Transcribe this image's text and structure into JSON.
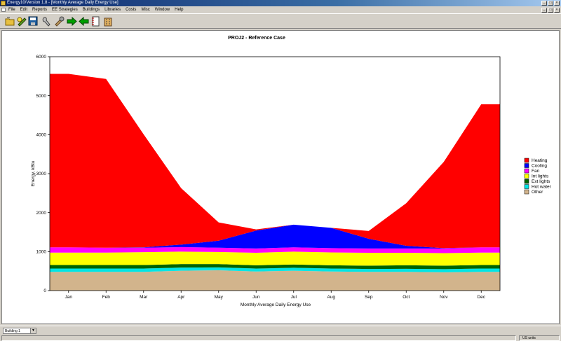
{
  "window": {
    "title": "Energy10/Version 1.8 - [Monthly Average Daily Energy Use]",
    "minimize": "_",
    "restore": "□",
    "close": "×"
  },
  "menu": [
    "File",
    "Edit",
    "Reports",
    "EE Strategies",
    "Buildings",
    "Libraries",
    "Costs",
    "Misc",
    "Window",
    "Help"
  ],
  "toolbar": [
    "open-icon",
    "lightbulb-icon",
    "save-icon",
    "wrench-icon",
    "tools-icon",
    "arrow-right-icon",
    "arrow-left-icon",
    "notebook-icon",
    "building-icon"
  ],
  "status": {
    "building": "Building 1",
    "units": "US units"
  },
  "chart_data": {
    "type": "area",
    "stacked": true,
    "title": "PROJ2 - Reference Case",
    "xlabel": "Monthly Average Daily Energy Use",
    "ylabel": "Energy, kBtu",
    "ylim": [
      0,
      6000
    ],
    "yticks": [
      0,
      1000,
      2000,
      3000,
      4000,
      5000,
      6000
    ],
    "categories": [
      "Jan",
      "Feb",
      "Mar",
      "Apr",
      "May",
      "Jun",
      "Jul",
      "Aug",
      "Sep",
      "Oct",
      "Nov",
      "Dec"
    ],
    "legend_position": "right",
    "series": [
      {
        "name": "Other",
        "color": "#d2b48c",
        "values": [
          480,
          480,
          480,
          510,
          520,
          490,
          510,
          490,
          480,
          480,
          470,
          480
        ]
      },
      {
        "name": "Hot water",
        "color": "#00e5e5",
        "values": [
          85,
          85,
          85,
          80,
          75,
          75,
          75,
          75,
          75,
          80,
          80,
          85
        ]
      },
      {
        "name": "Ext lights",
        "color": "#006400",
        "values": [
          90,
          90,
          90,
          90,
          85,
          85,
          85,
          85,
          85,
          90,
          90,
          90
        ]
      },
      {
        "name": "Int lights",
        "color": "#ffff00",
        "values": [
          320,
          320,
          330,
          320,
          310,
          320,
          330,
          330,
          330,
          320,
          320,
          320
        ]
      },
      {
        "name": "Fan",
        "color": "#ff00ff",
        "values": [
          135,
          125,
          115,
          115,
          110,
          110,
          110,
          110,
          110,
          110,
          120,
          135
        ]
      },
      {
        "name": "Cooling",
        "color": "#0000ff",
        "values": [
          0,
          0,
          10,
          65,
          180,
          460,
          580,
          520,
          250,
          70,
          10,
          0
        ]
      },
      {
        "name": "Heating",
        "color": "#ff0000",
        "values": [
          4450,
          4330,
          2900,
          1450,
          470,
          30,
          0,
          0,
          200,
          1090,
          2210,
          3670
        ]
      }
    ],
    "legend_order": [
      "Heating",
      "Cooling",
      "Fan",
      "Int lights",
      "Ext lights",
      "Hot water",
      "Other"
    ]
  }
}
